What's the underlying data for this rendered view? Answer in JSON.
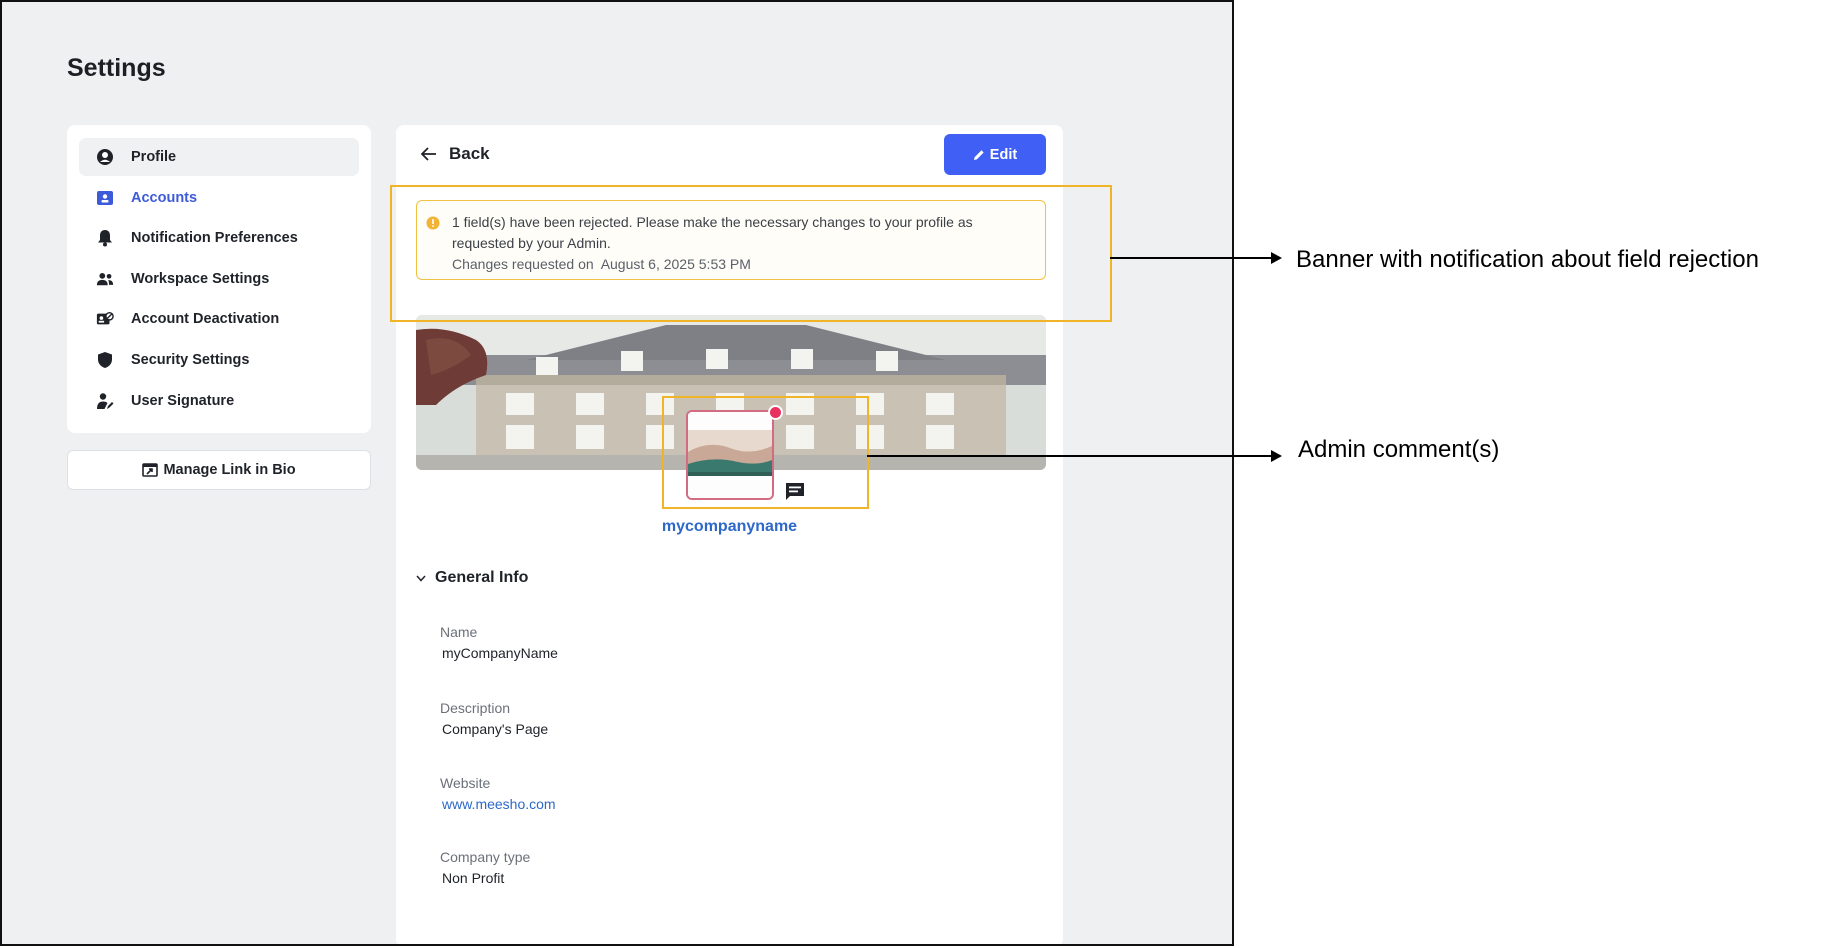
{
  "page": {
    "title": "Settings"
  },
  "sidebar": {
    "items": [
      {
        "label": "Profile",
        "icon": "user-circle-icon"
      },
      {
        "label": "Accounts",
        "icon": "id-card-icon"
      },
      {
        "label": "Notification Preferences",
        "icon": "bell-icon"
      },
      {
        "label": "Workspace Settings",
        "icon": "users-icon"
      },
      {
        "label": "Account Deactivation",
        "icon": "account-block-icon"
      },
      {
        "label": "Security Settings",
        "icon": "shield-icon"
      },
      {
        "label": "User Signature",
        "icon": "user-pen-icon"
      }
    ],
    "manage_link_label": "Manage Link in Bio"
  },
  "panel": {
    "back_label": "Back",
    "edit_label": "Edit",
    "banner": {
      "message": "1 field(s) have been rejected. Please make the necessary changes to your profile as requested by your Admin.",
      "meta_prefix": "Changes requested on",
      "meta_date": "August 6, 2025 5:53 PM"
    },
    "company_handle": "mycompanyname",
    "section_title": "General Info",
    "fields": [
      {
        "label": "Name",
        "value": "myCompanyName"
      },
      {
        "label": "Description",
        "value": "Company's Page"
      },
      {
        "label": "Website",
        "value": "www.meesho.com"
      },
      {
        "label": "Company type",
        "value": "Non Profit"
      }
    ]
  },
  "annotations": {
    "banner_callout": "Banner with notification about field rejection",
    "comment_callout": "Admin comment(s)"
  },
  "colors": {
    "accent": "#3f5ff5",
    "link": "#2e68c9",
    "highlight": "#f0b429",
    "notification_dot": "#e8315f"
  }
}
